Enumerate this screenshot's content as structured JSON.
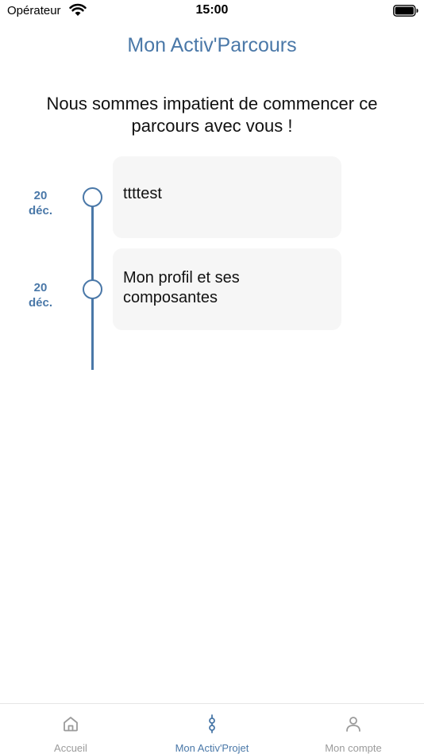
{
  "status_bar": {
    "carrier": "Opérateur",
    "time": "15:00"
  },
  "header": {
    "title": "Mon Activ'Parcours"
  },
  "intro": "Nous sommes impatient de commencer ce parcours avec vous !",
  "timeline": {
    "steps": [
      {
        "day": "20",
        "month": "déc.",
        "title": "ttttest"
      },
      {
        "day": "20",
        "month": "déc.",
        "title": "Mon profil et ses composantes"
      }
    ]
  },
  "tab_bar": {
    "tabs": [
      {
        "label": "Accueil",
        "icon": "home-icon",
        "active": false
      },
      {
        "label": "Mon Activ'Projet",
        "icon": "path-icon",
        "active": true
      },
      {
        "label": "Mon compte",
        "icon": "user-icon",
        "active": false
      }
    ]
  },
  "colors": {
    "accent": "#4a78a8",
    "card_bg": "#f6f6f6",
    "inactive_tab": "#9b9b9b"
  }
}
